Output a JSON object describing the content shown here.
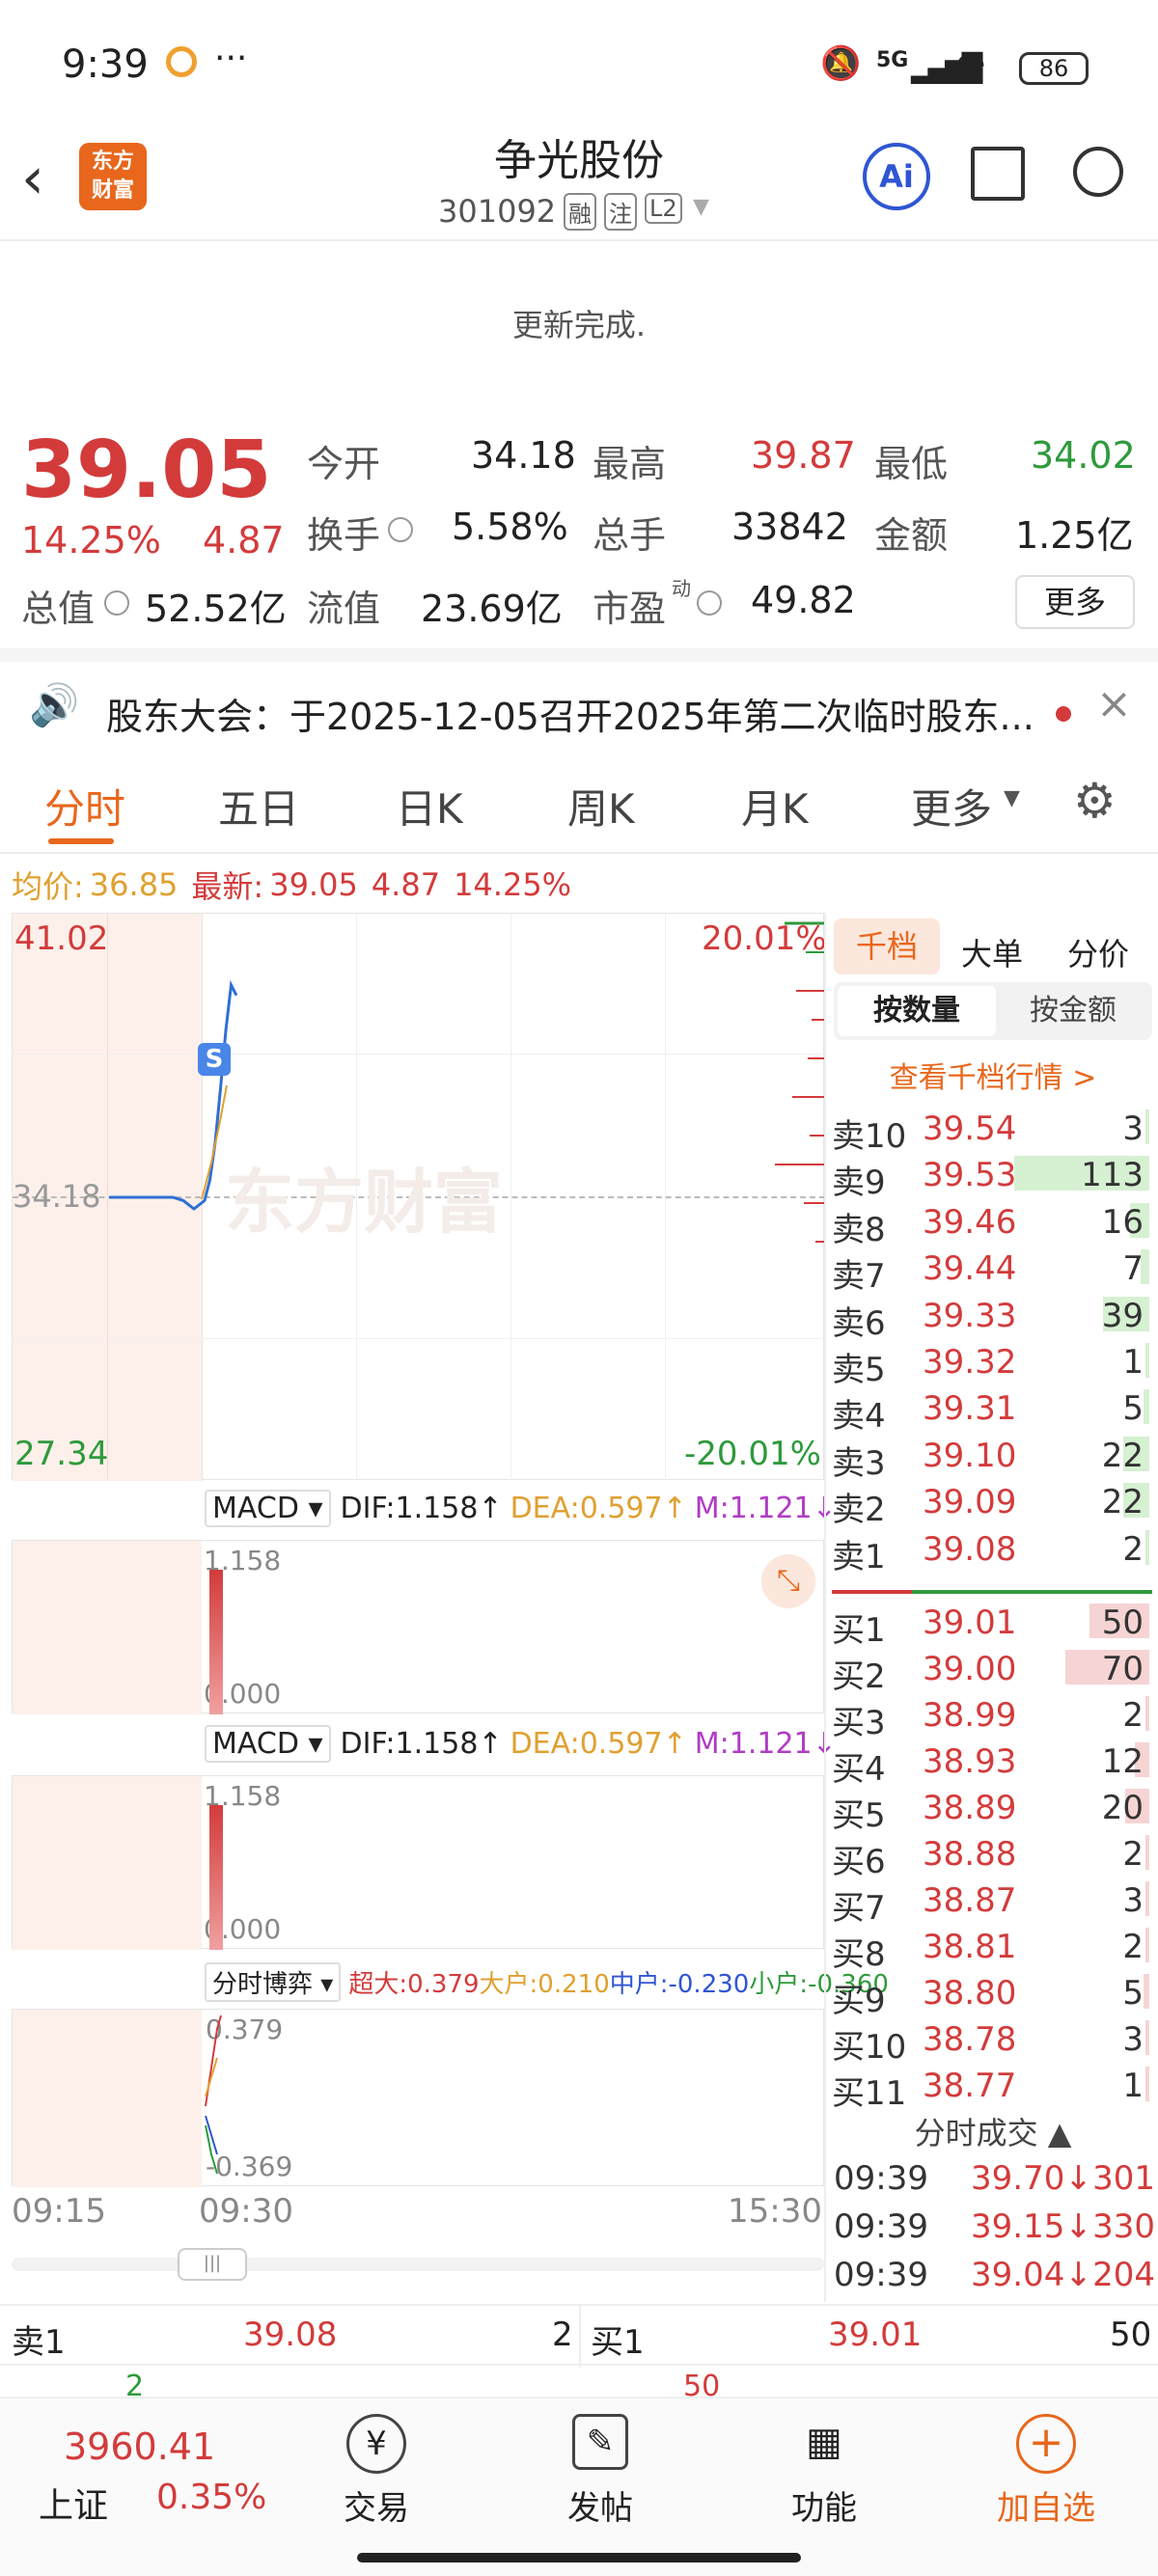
{
  "status": {
    "time": "9:39",
    "dots": "···",
    "network": "5G",
    "battery": "86"
  },
  "header": {
    "title": "争光股份",
    "code": "301092",
    "tag1": "融",
    "tag2": "注",
    "tag3": "L2",
    "logo": "东方\n财富",
    "ai": "Ai"
  },
  "notice": "更新完成.",
  "quote": {
    "price": "39.05",
    "pct": "14.25%",
    "chg": "4.87",
    "open_label": "今开",
    "open": "34.18",
    "high_label": "最高",
    "high": "39.87",
    "low_label": "最低",
    "low": "34.02",
    "turn_label": "换手",
    "turn": "5.58%",
    "vol_label": "总手",
    "vol": "33842",
    "amt_label": "金额",
    "amt": "1.25亿",
    "mcap_label": "总值",
    "mcap": "52.52亿",
    "fmcap_label": "流值",
    "fmcap": "23.69亿",
    "pe_label": "市盈",
    "pe_sup": "动",
    "pe": "49.82",
    "more": "更多"
  },
  "announce": "股东大会：于2025-12-05召开2025年第二次临时股东...",
  "tabs": [
    "分时",
    "五日",
    "日K",
    "周K",
    "月K",
    "更多"
  ],
  "chart": {
    "avg_label": "均价:",
    "avg": "36.85",
    "latest_label": "最新:",
    "latest": "39.05",
    "chg": "4.87",
    "pct": "14.25%",
    "ymax": "41.02",
    "ymin": "27.34",
    "pctmax": "20.01%",
    "pctmin": "-20.01%",
    "base": "34.18",
    "marker": "S",
    "watermark": "东方财富",
    "t1": "09:15",
    "t2": "09:30",
    "t3": "15:30",
    "line_x": [
      0,
      12,
      14,
      16,
      18,
      19,
      20,
      21,
      22,
      23,
      24
    ],
    "line_y": [
      34.18,
      34.18,
      34.1,
      33.9,
      34.1,
      34.6,
      35.5,
      36.8,
      38.2,
      39.3,
      39.05
    ]
  },
  "macd1": {
    "sel": "MACD",
    "dif": "DIF:1.158",
    "dea": "DEA:0.597",
    "m": "M:1.121",
    "top": "1.158",
    "bot": "0.000"
  },
  "macd2": {
    "sel": "MACD",
    "dif": "DIF:1.158",
    "dea": "DEA:0.597",
    "m": "M:1.121",
    "top": "1.158",
    "bot": "0.000"
  },
  "fund": {
    "sel": "分时博弈",
    "cd": "超大:0.379",
    "dh": "大户:0.210",
    "zh": "中户:-0.230",
    "xh": "小户:-0.360",
    "top": "0.379",
    "bot": "-0.369"
  },
  "book": {
    "tabs": [
      "千档",
      "大单",
      "分价"
    ],
    "sub": [
      "按数量",
      "按金额"
    ],
    "link": "查看千档行情 >",
    "asks": [
      [
        "卖10",
        "39.54",
        "3"
      ],
      [
        "卖9",
        "39.53",
        "113"
      ],
      [
        "卖8",
        "39.46",
        "16"
      ],
      [
        "卖7",
        "39.44",
        "7"
      ],
      [
        "卖6",
        "39.33",
        "39"
      ],
      [
        "卖5",
        "39.32",
        "1"
      ],
      [
        "卖4",
        "39.31",
        "5"
      ],
      [
        "卖3",
        "39.10",
        "22"
      ],
      [
        "卖2",
        "39.09",
        "22"
      ],
      [
        "卖1",
        "39.08",
        "2"
      ]
    ],
    "bids": [
      [
        "买1",
        "39.01",
        "50"
      ],
      [
        "买2",
        "39.00",
        "70"
      ],
      [
        "买3",
        "38.99",
        "2"
      ],
      [
        "买4",
        "38.93",
        "12"
      ],
      [
        "买5",
        "38.89",
        "20"
      ],
      [
        "买6",
        "38.88",
        "2"
      ],
      [
        "买7",
        "38.87",
        "3"
      ],
      [
        "买8",
        "38.81",
        "2"
      ],
      [
        "买9",
        "38.80",
        "5"
      ],
      [
        "买10",
        "38.78",
        "3"
      ],
      [
        "买11",
        "38.77",
        "1"
      ]
    ]
  },
  "trades": {
    "title": "分时成交",
    "rows": [
      [
        "09:39",
        "39.70↓",
        "301"
      ],
      [
        "09:39",
        "39.15↓",
        "330"
      ],
      [
        "09:39",
        "39.04↓",
        "204"
      ]
    ]
  },
  "bottom_quote": {
    "s1": "卖1",
    "s1p": "39.08",
    "s1v": "2",
    "b1": "买1",
    "b1p": "39.01",
    "b1v": "50",
    "s1v2": "2",
    "b1v2": "50"
  },
  "nav": {
    "index_val": "3960.41",
    "index_name": "上证",
    "index_pct": "0.35%",
    "items": [
      "交易",
      "发帖",
      "功能",
      "加自选"
    ]
  },
  "colors": {
    "red": "#d33b3b",
    "green": "#2f9a3c",
    "orange": "#e8671c",
    "blue": "#2f55d4"
  }
}
